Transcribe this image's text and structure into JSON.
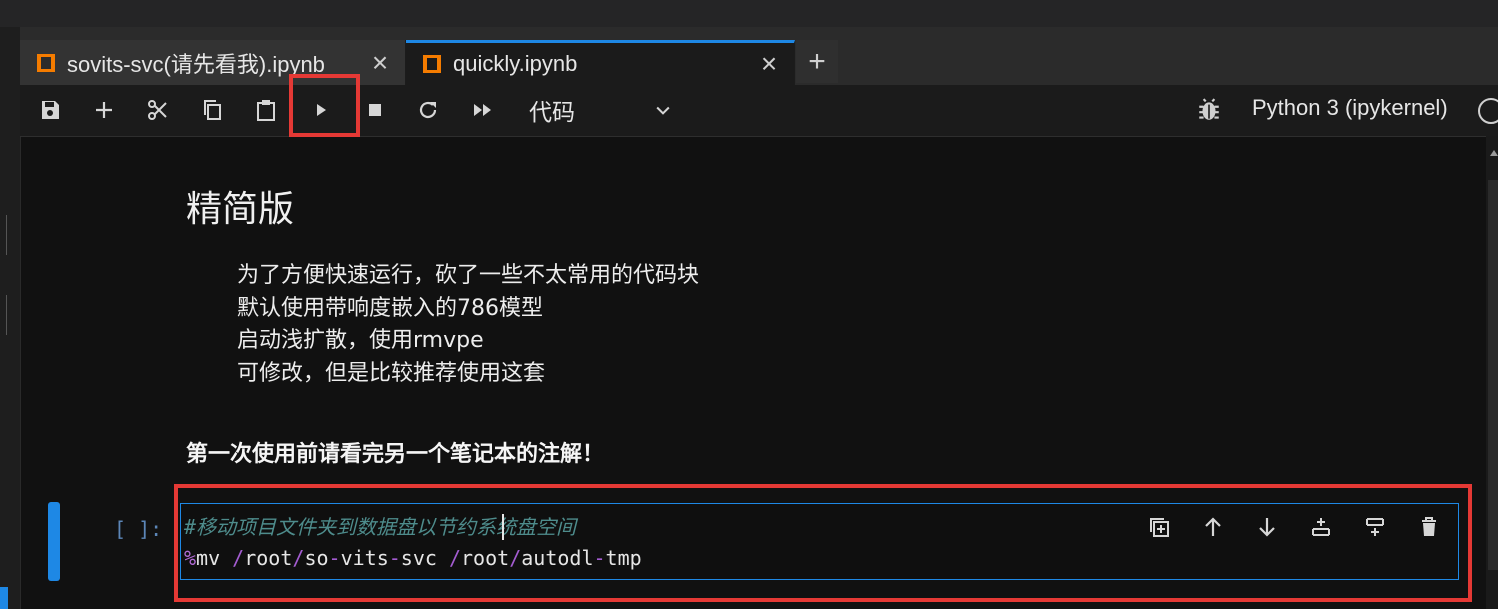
{
  "tabs": [
    {
      "title": "sovits-svc(请先看我).ipynb",
      "close": "×",
      "active": false
    },
    {
      "title": "quickly.ipynb",
      "close": "×",
      "active": true
    }
  ],
  "add_tab": "+",
  "toolbar": {
    "cell_type": "代码",
    "kernel_name": "Python 3 (ipykernel)",
    "buttons": [
      "save-icon",
      "add-icon",
      "cut-icon",
      "copy-icon",
      "paste-icon",
      "run-icon",
      "stop-icon",
      "restart-icon",
      "run-all-icon"
    ]
  },
  "markdown": {
    "heading": "精简版",
    "lines": [
      "为了方便快速运行，砍了一些不太常用的代码块",
      "默认使用带响度嵌入的786模型",
      "启动浅扩散，使用rmvpe",
      "可修改，但是比较推荐使用这套"
    ],
    "bold_note": "第一次使用前请看完另一个笔记本的注解！"
  },
  "code_cell": {
    "prompt": "[ ]:",
    "comment": "#移动项目文件夹到数据盘以节约系统盘空间",
    "line2": {
      "magic": "%",
      "cmd": "mv ",
      "s1": "/",
      "p1": "root",
      "s2": "/",
      "p2": "so",
      "d1": "-",
      "p3": "vits",
      "d2": "-",
      "p4": "svc ",
      "s3": "/",
      "p5": "root",
      "s4": "/",
      "p6": "autodl",
      "d3": "-",
      "p7": "tmp"
    },
    "tools": [
      "duplicate-icon",
      "move-up-icon",
      "move-down-icon",
      "insert-above-icon",
      "insert-below-icon",
      "delete-icon"
    ]
  },
  "colors": {
    "accent": "#1e88e5",
    "highlight": "#e53935",
    "notebook_icon": "#f57c00"
  }
}
